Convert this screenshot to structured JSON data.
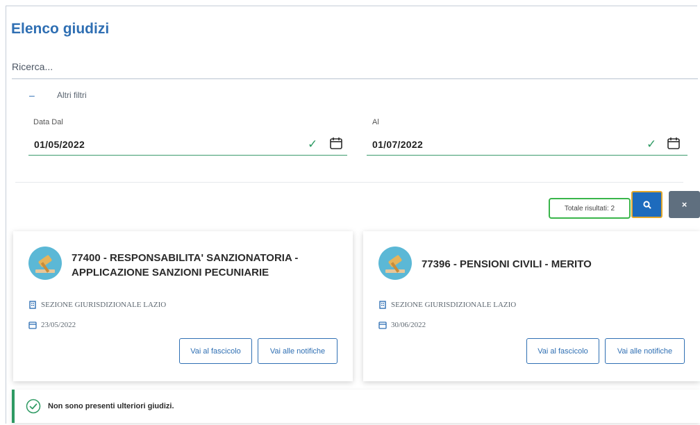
{
  "page": {
    "title": "Elenco giudizi"
  },
  "search": {
    "placeholder": "Ricerca..."
  },
  "filters": {
    "toggle_symbol": "–",
    "toggle_label": "Altri filtri",
    "date_from": {
      "label": "Data Dal",
      "value": "01/05/2022"
    },
    "date_to": {
      "label": "Al",
      "value": "01/07/2022"
    }
  },
  "results": {
    "total_label": "Totale risultati: 2"
  },
  "actions": {
    "clear_symbol": "×"
  },
  "cards": [
    {
      "title_line1": "77400 - RESPONSABILITA' SANZIONATORIA -",
      "title_line2": "APPLICAZIONE SANZIONI PECUNIARIE",
      "section": "SEZIONE GIURISDIZIONALE LAZIO",
      "date": "23/05/2022",
      "btn_fascicolo": "Vai al fascicolo",
      "btn_notifiche": "Vai alle notifiche"
    },
    {
      "title_line1": "77396 - PENSIONI CIVILI - MERITO",
      "title_line2": "",
      "section": "SEZIONE GIURISDIZIONALE LAZIO",
      "date": "30/06/2022",
      "btn_fascicolo": "Vai al fascicolo",
      "btn_notifiche": "Vai alle notifiche"
    }
  ],
  "alert": {
    "message": "Non sono presenti ulteriori giudizi."
  },
  "colors": {
    "primary": "#2f6fb3",
    "success": "#2e9a63",
    "focus": "#e3a72a",
    "neutral": "#5f6f7f"
  }
}
